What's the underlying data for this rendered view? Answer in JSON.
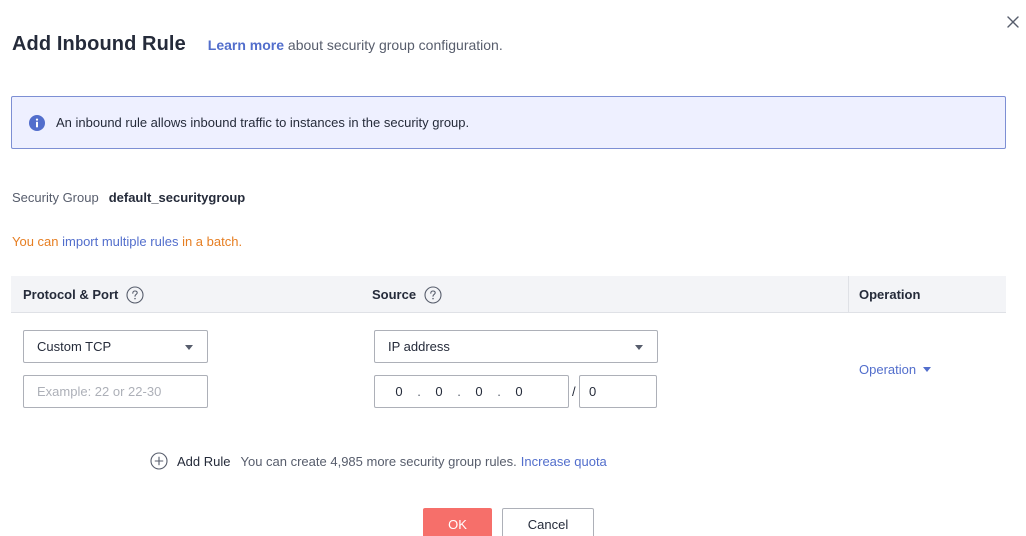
{
  "dialog": {
    "title": "Add Inbound Rule",
    "learn_more_link": "Learn more",
    "learn_more_suffix": " about security group configuration.",
    "close_icon": "close-icon"
  },
  "notice": {
    "icon": "info-icon",
    "text": "An inbound rule allows inbound traffic to instances in the security group."
  },
  "security_group": {
    "label": "Security Group",
    "value": "default_securitygroup"
  },
  "import": {
    "prefix": "You can ",
    "link": "import multiple rules",
    "suffix": " in a batch."
  },
  "table": {
    "columns": [
      {
        "label": "Protocol & Port",
        "help_icon": "help-circle-icon"
      },
      {
        "label": "Source",
        "help_icon": "help-circle-icon"
      },
      {
        "label": "Operation"
      }
    ],
    "row": {
      "protocol_value": "Custom TCP",
      "port_placeholder": "Example: 22 or 22-30",
      "source_type": "IP address",
      "ip": [
        "0",
        "0",
        "0",
        "0"
      ],
      "ip_separator": ".",
      "mask_separator": "/",
      "mask": "0",
      "operation_label": "Operation"
    }
  },
  "add_rule": {
    "icon": "plus-circle-icon",
    "label": "Add Rule",
    "quota_text": "You can create 4,985 more security group rules.",
    "quota_link": "Increase quota"
  },
  "footer": {
    "ok_label": "OK",
    "cancel_label": "Cancel"
  },
  "colors": {
    "link": "#526ecc",
    "primary_button": "#f66f6a",
    "notice_bg": "#eef0ff",
    "notice_border": "#7d8fd4",
    "import_text": "#e67e22"
  }
}
